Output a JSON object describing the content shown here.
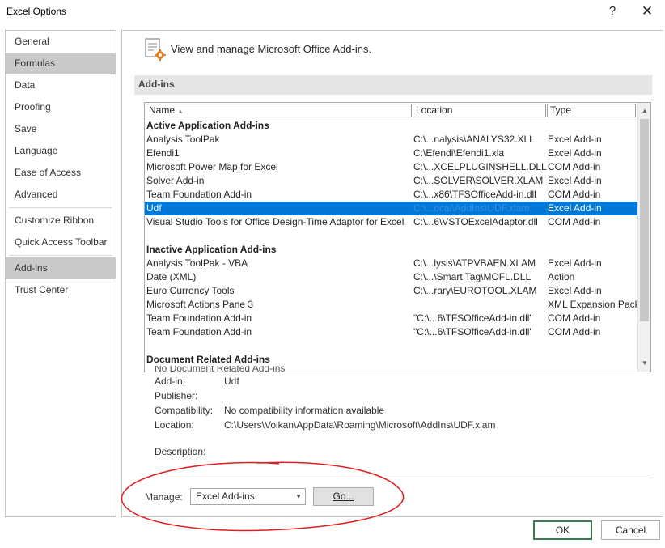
{
  "window": {
    "title": "Excel Options",
    "help_glyph": "?",
    "close_glyph": "✕"
  },
  "sidebar": {
    "items": [
      {
        "label": "General"
      },
      {
        "label": "Formulas"
      },
      {
        "label": "Data"
      },
      {
        "label": "Proofing"
      },
      {
        "label": "Save"
      },
      {
        "label": "Language"
      },
      {
        "label": "Ease of Access"
      },
      {
        "label": "Advanced"
      },
      {
        "label": "Customize Ribbon"
      },
      {
        "label": "Quick Access Toolbar"
      },
      {
        "label": "Add-ins"
      },
      {
        "label": "Trust Center"
      }
    ],
    "hover_item": "Formulas",
    "selected_item": "Add-ins"
  },
  "main": {
    "header": "View and manage Microsoft Office Add-ins.",
    "section_title": "Add-ins",
    "columns": {
      "name": "Name",
      "location": "Location",
      "type": "Type"
    },
    "groups": {
      "active": "Active Application Add-ins",
      "inactive": "Inactive Application Add-ins",
      "document": "Document Related Add-ins"
    },
    "active_rows": [
      {
        "name": "Analysis ToolPak",
        "location": "C:\\...nalysis\\ANALYS32.XLL",
        "type": "Excel Add-in"
      },
      {
        "name": "Efendi1",
        "location": "C:\\Efendi\\Efendi1.xla",
        "type": "Excel Add-in"
      },
      {
        "name": "Microsoft Power Map for Excel",
        "location": "C:\\...XCELPLUGINSHELL.DLL",
        "type": "COM Add-in"
      },
      {
        "name": "Solver Add-in",
        "location": "C:\\...SOLVER\\SOLVER.XLAM",
        "type": "Excel Add-in"
      },
      {
        "name": "Team Foundation Add-in",
        "location": "C:\\...x86\\TFSOfficeAdd-in.dll",
        "type": "COM Add-in"
      },
      {
        "name": "Udf",
        "location": "C:\\...ocal\\AddIns\\UDF.xlam",
        "type": "Excel Add-in"
      },
      {
        "name": "Visual Studio Tools for Office Design-Time Adaptor for Excel",
        "location": "C:\\...6\\VSTOExcelAdaptor.dll",
        "type": "COM Add-in"
      }
    ],
    "inactive_rows": [
      {
        "name": "Analysis ToolPak - VBA",
        "location": "C:\\...lysis\\ATPVBAEN.XLAM",
        "type": "Excel Add-in"
      },
      {
        "name": "Date (XML)",
        "location": "C:\\...\\Smart Tag\\MOFL.DLL",
        "type": "Action"
      },
      {
        "name": "Euro Currency Tools",
        "location": "C:\\...rary\\EUROTOOL.XLAM",
        "type": "Excel Add-in"
      },
      {
        "name": "Microsoft Actions Pane 3",
        "location": "",
        "type": "XML Expansion Pack"
      },
      {
        "name": "Team Foundation Add-in",
        "location": "\"C:\\...6\\TFSOfficeAdd-in.dll\"",
        "type": "COM Add-in"
      },
      {
        "name": "Team Foundation Add-in",
        "location": "\"C:\\...6\\TFSOfficeAdd-in.dll\"",
        "type": "COM Add-in"
      }
    ],
    "partial_row": "No Document Related Add-ins",
    "details": {
      "addin_label": "Add-in:",
      "addin_value": "Udf",
      "publisher_label": "Publisher:",
      "publisher_value": "",
      "compat_label": "Compatibility:",
      "compat_value": "No compatibility information available",
      "location_label": "Location:",
      "location_value": "C:\\Users\\Volkan\\AppData\\Roaming\\Microsoft\\AddIns\\UDF.xlam",
      "description_label": "Description:"
    },
    "manage": {
      "label": "Manage:",
      "selected": "Excel Add-ins",
      "go_label": "Go..."
    }
  },
  "footer": {
    "ok_label": "OK",
    "cancel_label": "Cancel"
  },
  "colors": {
    "selection": "#0078d7",
    "annotation_red": "#e02020",
    "ok_border": "#3c7a4f",
    "hover": "#c9c9c9"
  },
  "icons": {
    "header": "addins-gear-icon",
    "sort": "sort-up-icon",
    "dropdown": "chevron-down-icon",
    "scroll_up": "scroll-up-icon",
    "scroll_down": "scroll-down-icon"
  }
}
